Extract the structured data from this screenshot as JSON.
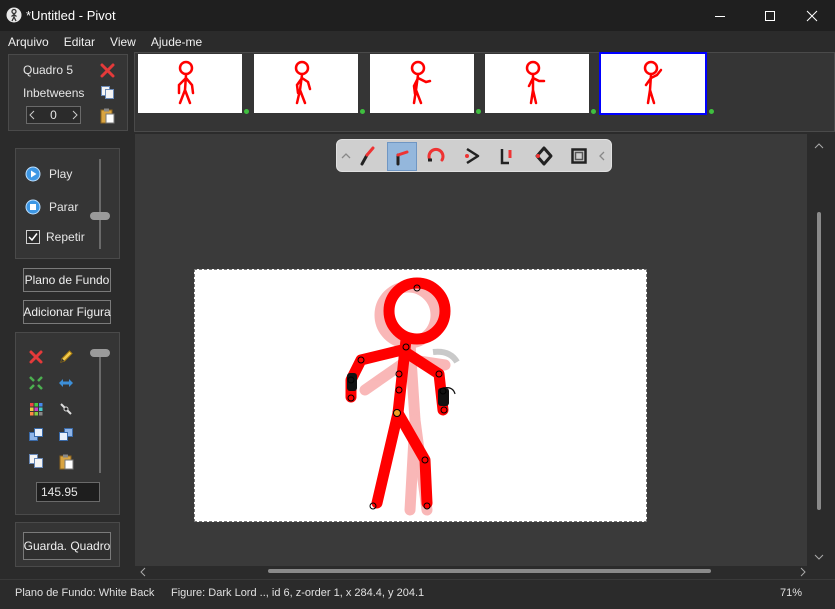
{
  "window": {
    "title": "*Untitled - Pivot",
    "minimize_icon": "minimize-icon",
    "maximize_icon": "maximize-icon",
    "close_icon": "close-icon"
  },
  "menu": [
    "Arquivo",
    "Editar",
    "View",
    "Ajude-me"
  ],
  "frame_panel": {
    "frame_label": "Quadro 5",
    "inbetweens_label": "Inbetweens",
    "inbetweens_value": "0"
  },
  "timeline": {
    "frames": [
      {
        "label": "frame-1",
        "selected": false
      },
      {
        "label": "frame-2",
        "selected": false
      },
      {
        "label": "frame-3",
        "selected": false
      },
      {
        "label": "frame-4",
        "selected": false
      },
      {
        "label": "frame-5",
        "selected": true
      }
    ],
    "selected_color": "#0000ff"
  },
  "playback": {
    "play_label": "Play",
    "stop_label": "Parar",
    "repeat_label": "Repetir",
    "repeat_checked": true
  },
  "buttons": {
    "background": "Plano de Fundo",
    "add_figure": "Adicionar Figura",
    "save_frame": "Guarda. Quadro"
  },
  "figure_tools": {
    "scale_value": "145.95"
  },
  "statusbar": {
    "background": "Plano de Fundo: White Back",
    "figure": "Figure: Dark Lord ..,  id 6,  z-order 1,  x 284.4, y 204.1",
    "zoom": "71%"
  },
  "colors": {
    "figure": "#ff0000",
    "onion": "#f6b3b3",
    "accent": "#0000ff"
  }
}
